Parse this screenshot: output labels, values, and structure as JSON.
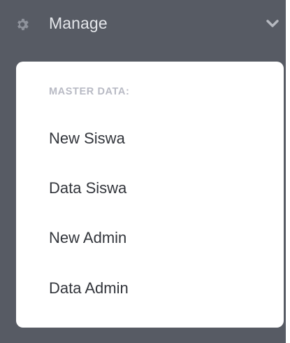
{
  "nav": {
    "icon": "gear-icon",
    "label": "Manage",
    "toggle_icon": "chevron-down-icon"
  },
  "dropdown": {
    "section_header": "MASTER DATA:",
    "items": [
      {
        "label": "New Siswa"
      },
      {
        "label": "Data Siswa"
      },
      {
        "label": "New Admin"
      },
      {
        "label": "Data Admin"
      }
    ]
  },
  "colors": {
    "sidebar_bg": "#575b64",
    "dropdown_bg": "#ffffff",
    "header_text": "#e4e6ea",
    "section_header_text": "#b8bac4",
    "item_text": "#32353b"
  }
}
